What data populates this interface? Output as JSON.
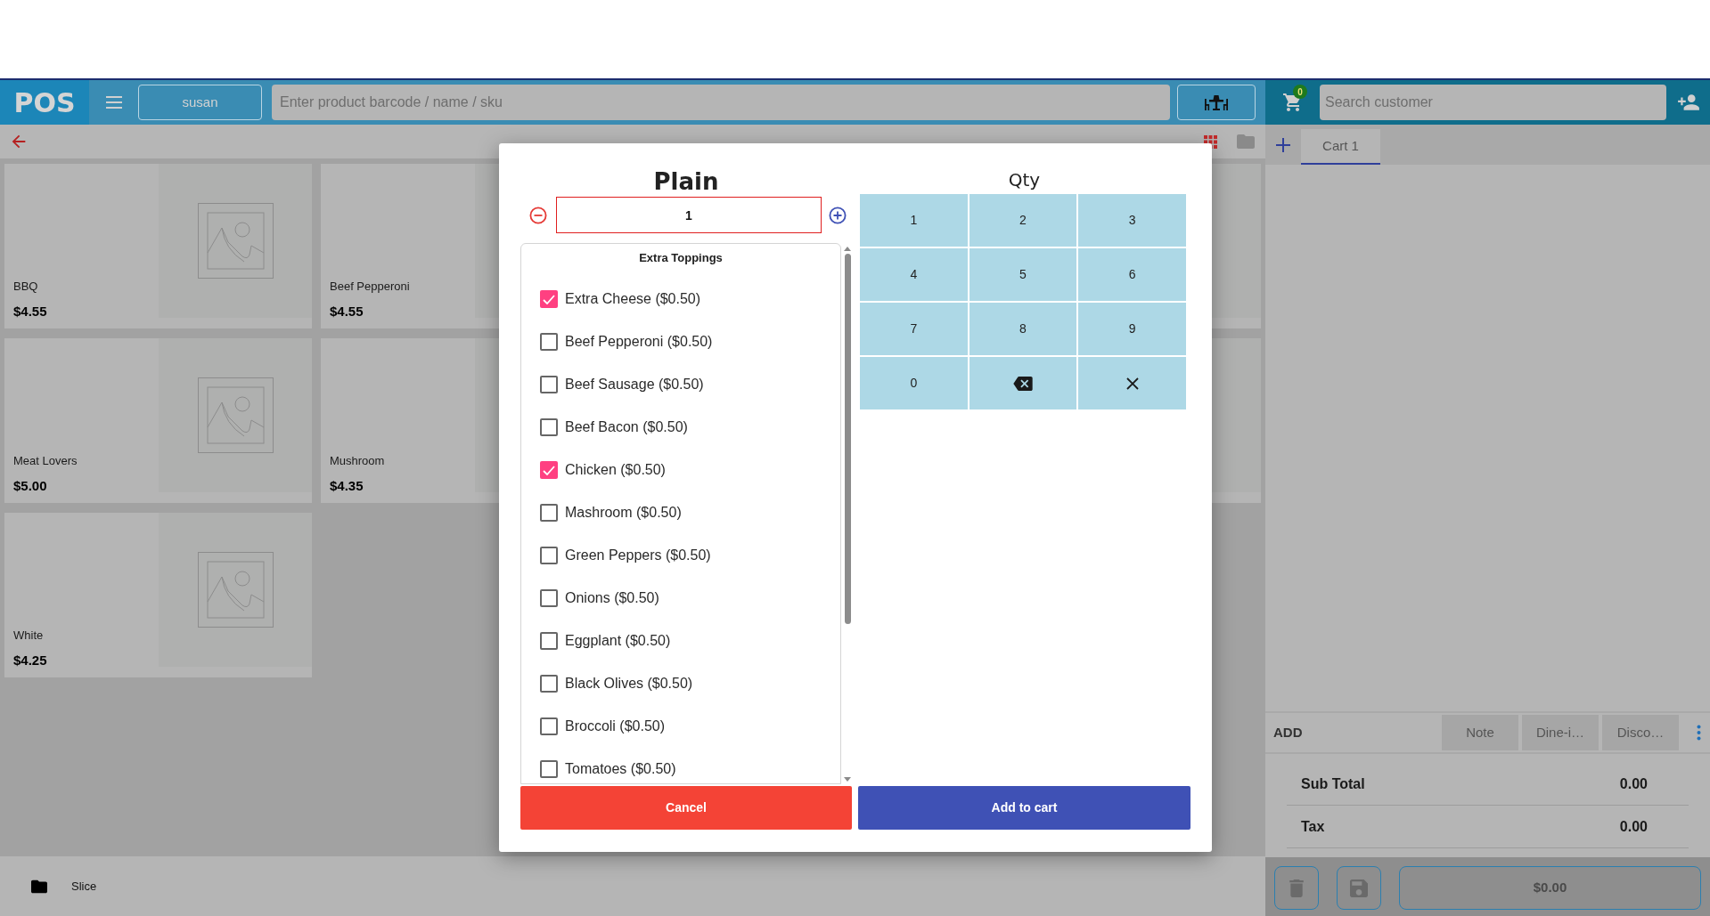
{
  "header": {
    "logo": "POS",
    "user_button": "susan",
    "product_search": {
      "placeholder": "Enter product barcode / name / sku"
    },
    "cart_count": "0",
    "customer_search": {
      "placeholder": "Search customer"
    }
  },
  "products": [
    {
      "kind": "product",
      "name": "BBQ",
      "price": "$4.55"
    },
    {
      "kind": "product",
      "name": "Beef Pepperoni",
      "price": "$4.55"
    },
    {
      "kind": "partial"
    },
    {
      "kind": "product",
      "name": "Meat Lovers",
      "price": "$5.00"
    },
    {
      "kind": "product",
      "name": "Mushroom",
      "price": "$4.35"
    },
    {
      "kind": "partial"
    },
    {
      "kind": "product",
      "name": "White",
      "price": "$4.25"
    }
  ],
  "category": "Slice",
  "cart": {
    "tabs": [
      {
        "label": "Cart 1",
        "selected": true
      }
    ],
    "add_label": "ADD",
    "actions": [
      "Note",
      "Dine-i…",
      "Disco…"
    ],
    "totals": [
      {
        "label": "Sub Total",
        "value": "0.00"
      },
      {
        "label": "Tax",
        "value": "0.00"
      }
    ],
    "pay_button": "$0.00"
  },
  "modal": {
    "title": "Plain",
    "quantity": "1",
    "toppings": {
      "title": "Extra Toppings",
      "items": [
        {
          "label": "Extra Cheese ($0.50)",
          "checked": true
        },
        {
          "label": "Beef Pepperoni ($0.50)",
          "checked": false
        },
        {
          "label": "Beef Sausage ($0.50)",
          "checked": false
        },
        {
          "label": "Beef Bacon ($0.50)",
          "checked": false
        },
        {
          "label": "Chicken ($0.50)",
          "checked": true
        },
        {
          "label": "Mashroom ($0.50)",
          "checked": false
        },
        {
          "label": "Green Peppers ($0.50)",
          "checked": false
        },
        {
          "label": "Onions ($0.50)",
          "checked": false
        },
        {
          "label": "Eggplant ($0.50)",
          "checked": false
        },
        {
          "label": "Black Olives ($0.50)",
          "checked": false
        },
        {
          "label": "Broccoli ($0.50)",
          "checked": false
        },
        {
          "label": "Tomatoes ($0.50)",
          "checked": false
        }
      ]
    },
    "keypad": {
      "title": "Qty",
      "keys": [
        {
          "kind": "digit",
          "label": "1"
        },
        {
          "kind": "digit",
          "label": "2"
        },
        {
          "kind": "digit",
          "label": "3"
        },
        {
          "kind": "digit",
          "label": "4"
        },
        {
          "kind": "digit",
          "label": "5"
        },
        {
          "kind": "digit",
          "label": "6"
        },
        {
          "kind": "digit",
          "label": "7"
        },
        {
          "kind": "digit",
          "label": "8"
        },
        {
          "kind": "digit",
          "label": "9"
        },
        {
          "kind": "digit",
          "label": "0"
        },
        {
          "kind": "backspace"
        },
        {
          "kind": "clear"
        }
      ]
    },
    "cancel_button": "Cancel",
    "confirm_button": "Add to cart"
  }
}
